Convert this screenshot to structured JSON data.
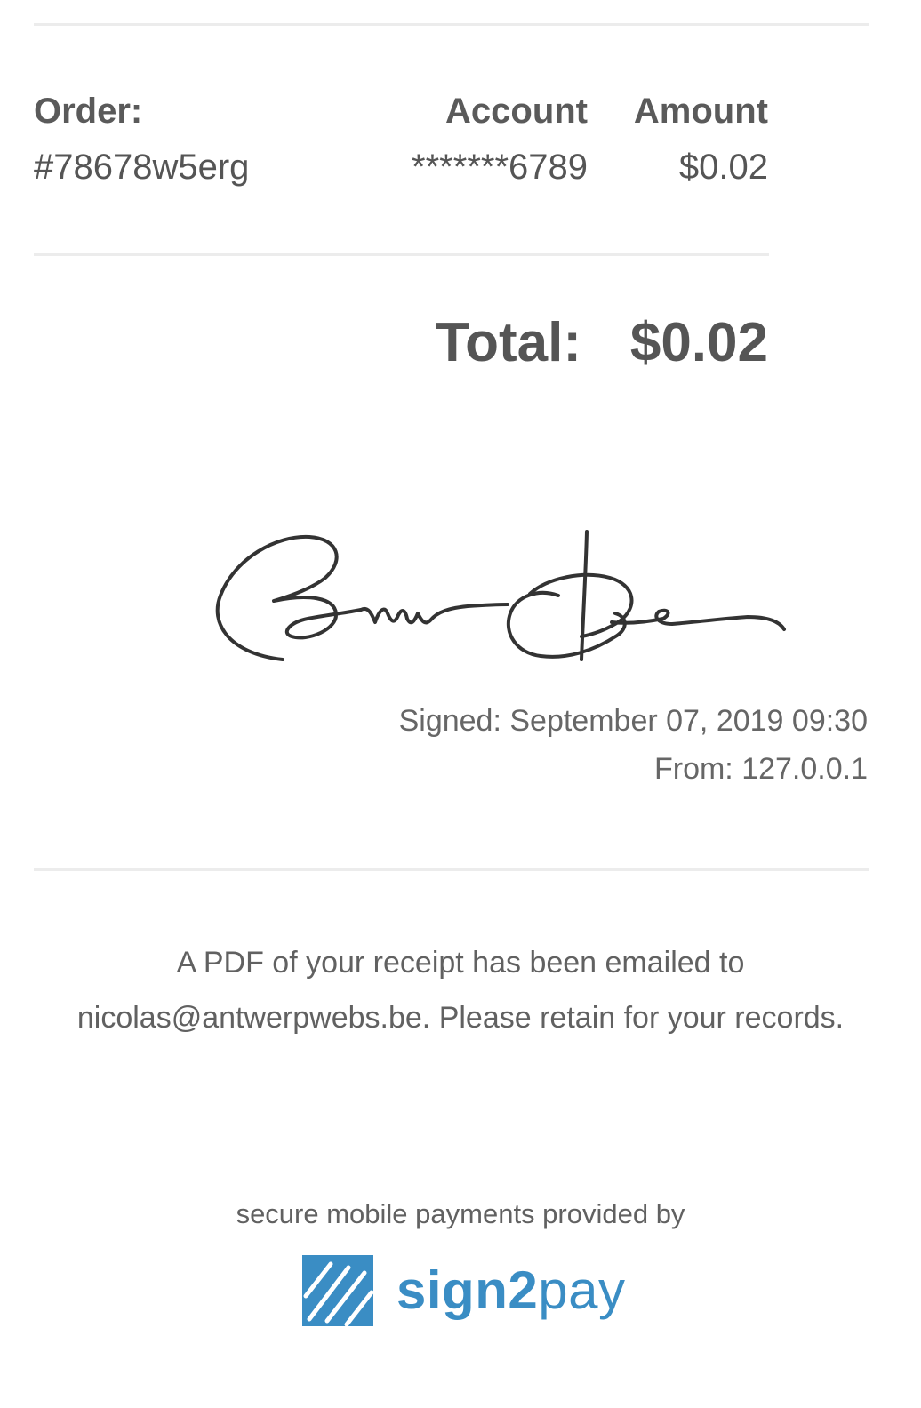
{
  "order": {
    "label": "Order:",
    "number": "#78678w5erg"
  },
  "account": {
    "label": "Account",
    "value": "*******6789"
  },
  "amount": {
    "label": "Amount",
    "value": "$0.02"
  },
  "total": {
    "label": "Total:",
    "value": "$0.02"
  },
  "signature": {
    "signed": "Signed: September 07, 2019 09:30",
    "from": "From: 127.0.0.1"
  },
  "notice": "A PDF of your receipt has been emailed to nicolas@antwerpwebs.be. Please retain for your records.",
  "footer": {
    "tagline": "secure mobile payments provided by",
    "brand_part1": "sign2",
    "brand_part2": "pay",
    "brand_color": "#3a8dc4"
  },
  "icons": {
    "brand_logo": "sign2pay-logo-icon"
  }
}
